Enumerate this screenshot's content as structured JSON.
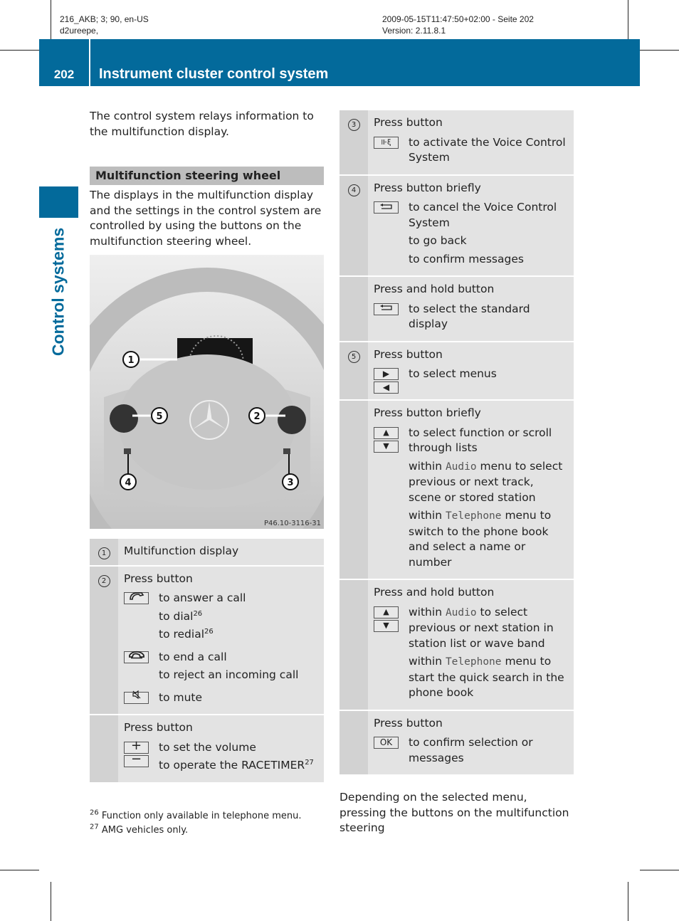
{
  "print_meta": {
    "left_line1": "216_AKB; 3; 90, en-US",
    "left_line2": "d2ureepe,",
    "right_line1": "2009-05-15T11:47:50+02:00 - Seite 202",
    "right_line2": "Version: 2.11.8.1"
  },
  "header": {
    "page_number": "202",
    "title": "Instrument cluster control system",
    "color": "#036a9b"
  },
  "side_tab": {
    "label": "Control systems"
  },
  "left": {
    "intro": "The control system relays information to the multifunction display.",
    "section_heading": "Multifunction steering wheel",
    "section_text": "The displays in the multifunction display and the settings in the control system are controlled by using the buttons on the multifunction steering wheel.",
    "figure": {
      "caption_code": "P46.10-3116-31",
      "callouts": [
        "1",
        "2",
        "3",
        "4",
        "5"
      ]
    },
    "legend": [
      {
        "num": "①",
        "lead": "Multifunction display",
        "lines": []
      },
      {
        "num": "②",
        "lead": "Press button",
        "lines": [
          {
            "keys": [
              "phone-answer-icon"
            ],
            "texts": [
              "to answer a call",
              "to dial",
              "to redial"
            ],
            "sups": [
              "",
              "26",
              "26"
            ]
          },
          {
            "keys": [
              "phone-end-icon"
            ],
            "texts": [
              "to end a call",
              "to reject an incoming call"
            ],
            "sups": [
              "",
              ""
            ]
          },
          {
            "keys": [
              "mute-icon"
            ],
            "texts": [
              "to mute"
            ],
            "sups": [
              ""
            ]
          }
        ]
      },
      {
        "num": "",
        "lead": "Press button",
        "lines": [
          {
            "keys": [
              "plus-icon",
              "minus-icon"
            ],
            "texts": [
              "to set the volume",
              "to operate the RACETIMER"
            ],
            "sups": [
              "",
              "27"
            ]
          }
        ]
      }
    ]
  },
  "right": {
    "legend": [
      {
        "num": "③",
        "lead": "Press button",
        "lines": [
          {
            "keys": [
              "voice-control-icon"
            ],
            "texts": [
              "to activate the Voice Control System"
            ]
          }
        ]
      },
      {
        "num": "④",
        "lead": "Press button briefly",
        "lines": [
          {
            "keys": [
              "back-icon"
            ],
            "texts": [
              "to cancel the Voice Control System",
              "to go back",
              "to confirm messages"
            ]
          }
        ]
      },
      {
        "num": "",
        "lead": "Press and hold button",
        "lines": [
          {
            "keys": [
              "back-icon"
            ],
            "texts": [
              "to select the standard display"
            ]
          }
        ]
      },
      {
        "num": "⑤",
        "lead": "Press button",
        "lines": [
          {
            "keys": [
              "right-arrow-icon",
              "left-arrow-icon"
            ],
            "texts": [
              "to select menus"
            ]
          }
        ]
      },
      {
        "num": "",
        "lead": "Press button briefly",
        "lines": [
          {
            "keys": [
              "up-arrow-icon",
              "down-arrow-icon"
            ],
            "texts": [
              "to select function or scroll through lists"
            ]
          }
        ],
        "extra": [
          {
            "pre": "within ",
            "mono": "Audio",
            "post": " menu to select previous or next track, scene or stored station"
          },
          {
            "pre": "within ",
            "mono": "Telephone",
            "post": " menu to switch to the phone book and select a name or number"
          }
        ]
      },
      {
        "num": "",
        "lead": "Press and hold button",
        "lines": [
          {
            "keys": [
              "up-arrow-icon",
              "down-arrow-icon"
            ],
            "texts": []
          }
        ],
        "extra": [
          {
            "pre": "within ",
            "mono": "Audio",
            "post": " to select previous or next station in station list or wave band"
          },
          {
            "pre": "within ",
            "mono": "Telephone",
            "post": " menu to start the quick search in the phone book"
          }
        ]
      },
      {
        "num": "",
        "lead": "Press button",
        "lines": [
          {
            "keys": [
              "ok-key"
            ],
            "texts": [
              "to confirm selection or messages"
            ]
          }
        ]
      }
    ],
    "ok_label": "OK",
    "outro": "Depending on the selected menu, pressing the buttons on the multifunction steering"
  },
  "footnotes": [
    {
      "num": "26",
      "text": "Function only available in telephone menu."
    },
    {
      "num": "27",
      "text": "AMG vehicles only."
    }
  ]
}
